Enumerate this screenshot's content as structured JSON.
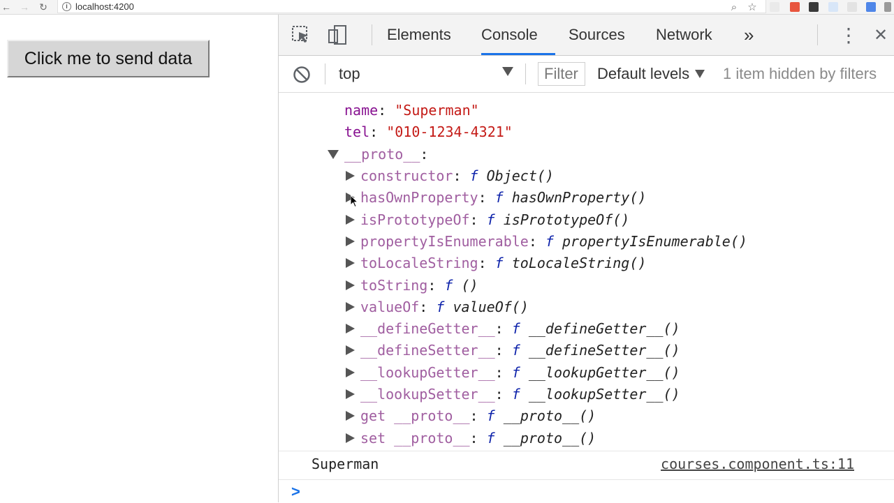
{
  "browser": {
    "url": "localhost:4200",
    "info_glyph": "i",
    "back_glyph": "←",
    "forward_glyph": "→",
    "reload_glyph": "↻",
    "zoom_glyph": "⌕",
    "star_glyph": "☆"
  },
  "page": {
    "button_label": "Click me to send data"
  },
  "devtools": {
    "tabs": [
      "Elements",
      "Console",
      "Sources",
      "Network"
    ],
    "active_tab": "Console",
    "more_tabs_glyph": "»",
    "menu_glyph": "⋮",
    "close_glyph": "✕",
    "toolbar": {
      "context": "top",
      "filter_placeholder": "Filter",
      "levels": "Default levels",
      "hidden_info": "1 item hidden by filters"
    },
    "object_lines": [
      {
        "key": "name",
        "kind": "own",
        "value": "\"Superman\"",
        "vtype": "string"
      },
      {
        "key": "tel",
        "kind": "own",
        "value": "\"010-1234-4321\"",
        "vtype": "string"
      }
    ],
    "proto_label": "__proto__",
    "proto_entries": [
      {
        "key": "constructor",
        "func": "Object()"
      },
      {
        "key": "hasOwnProperty",
        "func": "hasOwnProperty()"
      },
      {
        "key": "isPrototypeOf",
        "func": "isPrototypeOf()"
      },
      {
        "key": "propertyIsEnumerable",
        "func": "propertyIsEnumerable()"
      },
      {
        "key": "toLocaleString",
        "func": "toLocaleString()"
      },
      {
        "key": "toString",
        "func": "()"
      },
      {
        "key": "valueOf",
        "func": "valueOf()"
      },
      {
        "key": "__defineGetter__",
        "func": "__defineGetter__()"
      },
      {
        "key": "__defineSetter__",
        "func": "__defineSetter__()"
      },
      {
        "key": "__lookupGetter__",
        "func": "__lookupGetter__()"
      },
      {
        "key": "__lookupSetter__",
        "func": "__lookupSetter__()"
      },
      {
        "key": "get __proto__",
        "func": "__proto__()"
      },
      {
        "key": "set __proto__",
        "func": "__proto__()"
      }
    ],
    "f_glyph": "f",
    "log_message": "Superman",
    "log_source": "courses.component.ts:11",
    "prompt_glyph": ">"
  },
  "colors": {
    "accent": "#1a73e8",
    "own_key": "#881391",
    "proto_key": "#a05ea0",
    "string": "#c41a16",
    "function_keyword": "#0d22aa"
  }
}
